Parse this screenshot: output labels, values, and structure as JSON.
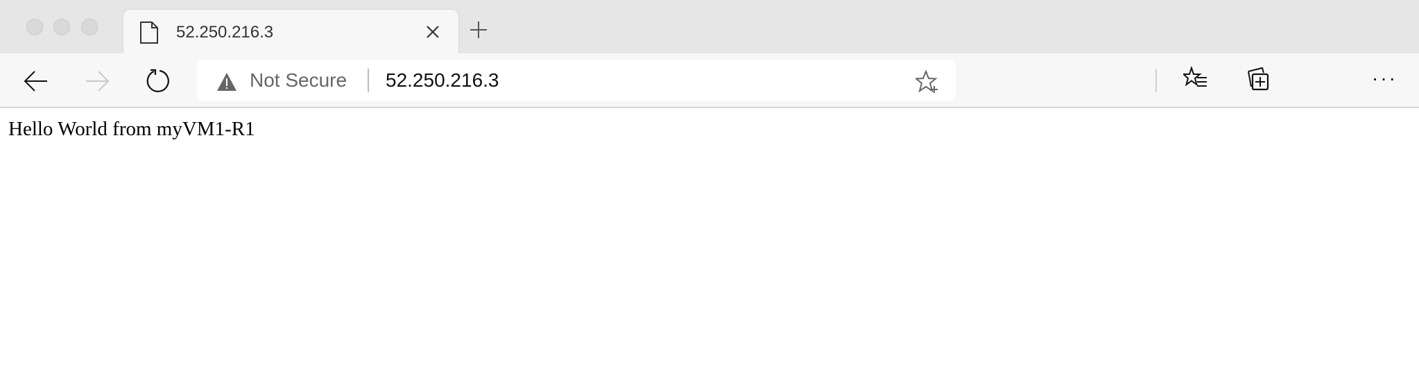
{
  "browser": {
    "tab": {
      "title": "52.250.216.3",
      "icon": "page-icon"
    },
    "new_tab_icon": "plus-icon",
    "toolbar": {
      "back_icon": "arrow-left-icon",
      "forward_icon": "arrow-right-icon",
      "refresh_icon": "refresh-icon",
      "security_label": "Not Secure",
      "security_icon": "warning-icon",
      "url": "52.250.216.3",
      "add_favorite_icon": "star-plus-icon",
      "favorites_icon": "favorites-list-icon",
      "collections_icon": "collections-icon",
      "menu_icon": "more-icon",
      "menu_label": "···"
    }
  },
  "page": {
    "body_text": "Hello World from myVM1-R1"
  },
  "colors": {
    "tabstrip": "#e6e6e6",
    "toolbar": "#f7f7f7",
    "warning": "#666666"
  }
}
